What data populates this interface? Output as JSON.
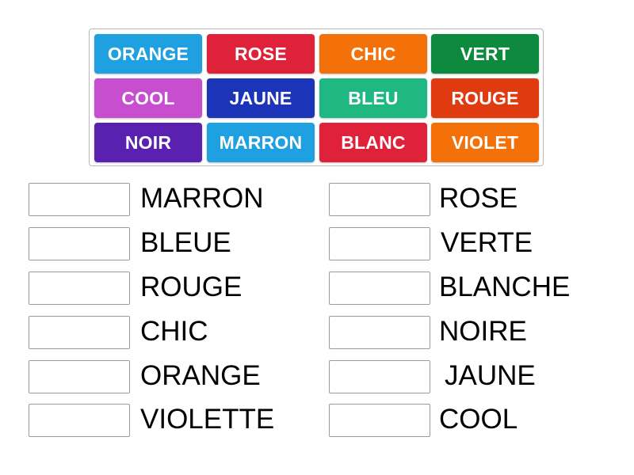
{
  "tiles": [
    {
      "label": "ORANGE",
      "color": "#1fa0e0"
    },
    {
      "label": "ROSE",
      "color": "#e0213a"
    },
    {
      "label": "CHIC",
      "color": "#f47008"
    },
    {
      "label": "VERT",
      "color": "#0e8a3e"
    },
    {
      "label": "COOL",
      "color": "#c84ed0"
    },
    {
      "label": "JAUNE",
      "color": "#1c35b8"
    },
    {
      "label": "BLEU",
      "color": "#1fb883"
    },
    {
      "label": "ROUGE",
      "color": "#e03a10"
    },
    {
      "label": "NOIR",
      "color": "#5a20b0"
    },
    {
      "label": "MARRON",
      "color": "#1fa0e0"
    },
    {
      "label": "BLANC",
      "color": "#e0213a"
    },
    {
      "label": "VIOLET",
      "color": "#f47008"
    }
  ],
  "left_column": [
    {
      "word": "MARRON"
    },
    {
      "word": "BLEUE"
    },
    {
      "word": "ROUGE"
    },
    {
      "word": "CHIC"
    },
    {
      "word": "ORANGE"
    },
    {
      "word": "VIOLETTE"
    }
  ],
  "right_column": [
    {
      "word": "ROSE"
    },
    {
      "word": "VERTE"
    },
    {
      "word": "BLANCHE"
    },
    {
      "word": "NOIRE"
    },
    {
      "word": "JAUNE"
    },
    {
      "word": "COOL"
    }
  ]
}
